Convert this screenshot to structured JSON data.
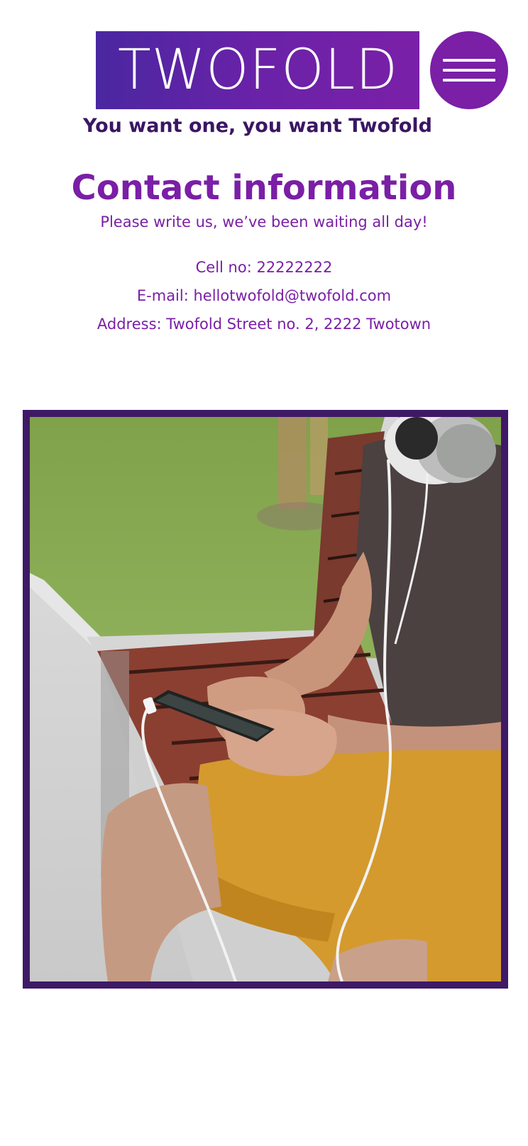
{
  "header": {
    "logo_text": "TWOFOLD",
    "tagline": "You want one, you want Twofold"
  },
  "contact": {
    "title": "Contact information",
    "subtitle": "Please write us, we’ve been waiting all day!",
    "cell": "Cell no: 22222222",
    "email": "E-mail: hellotwofold@twofold.com",
    "address": "Address: Twofold Street no. 2, 2222 Twotown"
  },
  "icons": {
    "menu": "hamburger-menu-icon"
  },
  "colors": {
    "brand_purple": "#7a1fa6",
    "brand_dark_purple": "#3e1a66",
    "logo_gradient_start": "#4a27a0",
    "logo_gradient_end": "#7a20a8"
  }
}
